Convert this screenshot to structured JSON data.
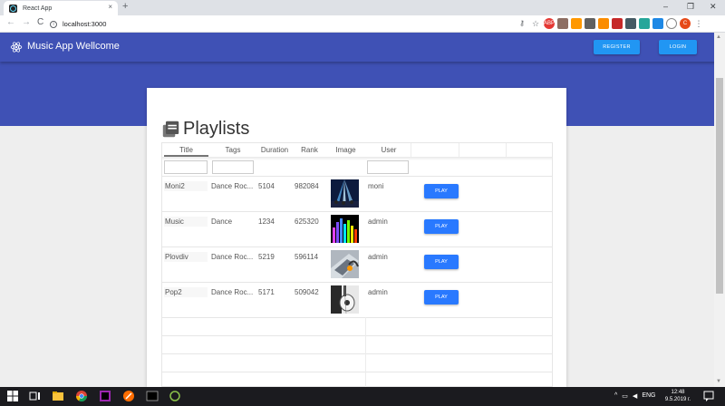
{
  "browser": {
    "tab_title": "React App",
    "tab_close": "×",
    "new_tab": "+",
    "win_min": "–",
    "win_max": "❐",
    "win_close": "✕",
    "back": "←",
    "forward": "→",
    "reload": "C",
    "info": "i",
    "url": "localhost:3000",
    "ext_abp": "ABP",
    "profile": "C"
  },
  "header": {
    "title": "Music App Wellcome",
    "register_label": "REGISTER",
    "login_label": "LOGIN",
    "brand_color": "#3f51b5",
    "button_color": "#2196f3"
  },
  "playlists": {
    "title": "Playlists",
    "columns": [
      "Title",
      "Tags",
      "Duration",
      "Rank",
      "Image",
      "User"
    ],
    "play_label": "PLAY",
    "rows": [
      {
        "title": "Moni2",
        "tags": "Dance Roc...",
        "duration": "5104",
        "rank": "982084",
        "image": "concert-lights",
        "user": "moni"
      },
      {
        "title": "Music",
        "tags": "Dance",
        "duration": "1234",
        "rank": "625320",
        "image": "equalizer-bars",
        "user": "admin"
      },
      {
        "title": "Plovdiv",
        "tags": "Dance Roc...",
        "duration": "5219",
        "rank": "596114",
        "image": "headphones-laptop",
        "user": "admin"
      },
      {
        "title": "Pop2",
        "tags": "Dance Roc...",
        "duration": "5171",
        "rank": "509042",
        "image": "guitar-bw",
        "user": "admin"
      }
    ]
  },
  "taskbar": {
    "lang": "ENG",
    "time": "12:48",
    "date": "9.5.2019 г."
  }
}
